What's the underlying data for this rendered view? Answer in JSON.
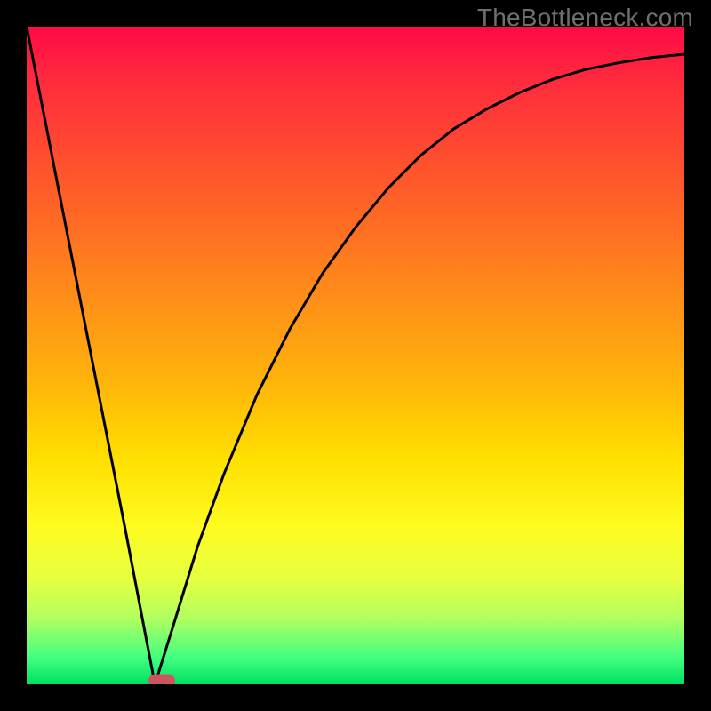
{
  "watermark": "TheBottleneck.com",
  "chart_data": {
    "type": "line",
    "title": "",
    "xlabel": "",
    "ylabel": "",
    "xlim": [
      0,
      1
    ],
    "ylim": [
      0,
      1
    ],
    "legend": false,
    "grid": false,
    "series": [
      {
        "name": "curve",
        "x": [
          0.0,
          0.05,
          0.1,
          0.15,
          0.195,
          0.22,
          0.26,
          0.3,
          0.35,
          0.4,
          0.45,
          0.5,
          0.55,
          0.6,
          0.65,
          0.7,
          0.75,
          0.8,
          0.85,
          0.9,
          0.95,
          1.0
        ],
        "y": [
          1.0,
          0.745,
          0.49,
          0.235,
          0.0,
          0.08,
          0.21,
          0.32,
          0.44,
          0.54,
          0.625,
          0.695,
          0.755,
          0.805,
          0.845,
          0.875,
          0.9,
          0.92,
          0.935,
          0.945,
          0.953,
          0.958
        ]
      }
    ],
    "marker": {
      "x": 0.205,
      "y": 0.005
    },
    "background_gradient": {
      "top": "#ff0a46",
      "mid": "#ffe000",
      "bottom": "#00e060"
    }
  }
}
